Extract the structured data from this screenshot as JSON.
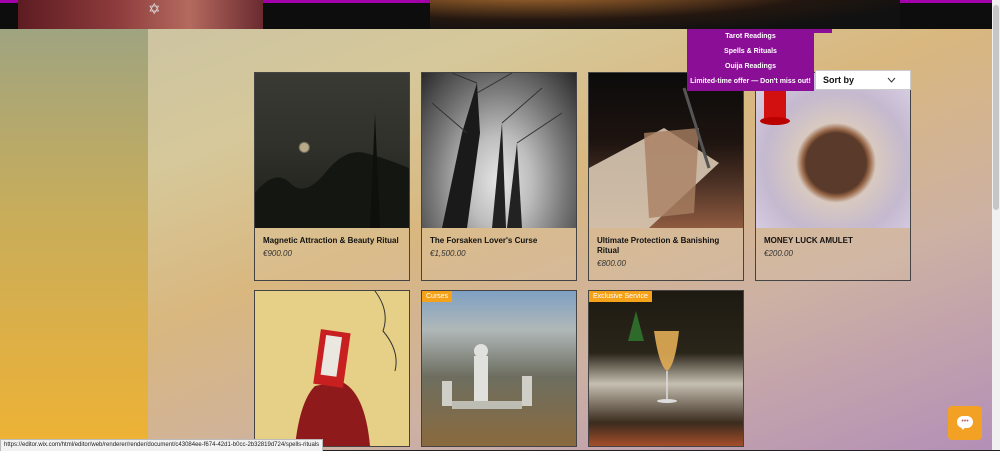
{
  "menu": {
    "items": [
      {
        "label": "Tarot Readings"
      },
      {
        "label": "Spells & Rituals"
      },
      {
        "label": "Ouija Readings"
      },
      {
        "label": "Limited-time offer — Don't miss out!"
      }
    ]
  },
  "sort": {
    "label": "Sort by"
  },
  "products": [
    {
      "title": "Magnetic Attraction & Beauty Ritual",
      "price": "€900.00",
      "ribbon": "",
      "image": "moon-photo"
    },
    {
      "title": "The Forsaken Lover's Curse",
      "price": "€1,500.00",
      "ribbon": "",
      "image": "trees-photo"
    },
    {
      "title": "Ultimate Protection & Banishing Ritual",
      "price": "€800.00",
      "ribbon": "",
      "image": "book-photo"
    },
    {
      "title": "MONEY LUCK AMULET",
      "price": "€200.00",
      "ribbon": "",
      "image": "amulet-photo"
    },
    {
      "title": "",
      "price": "",
      "ribbon": "",
      "image": "hooded-figure-photo"
    },
    {
      "title": "",
      "price": "",
      "ribbon": "Curses",
      "image": "cemetery-photo"
    },
    {
      "title": "",
      "price": "",
      "ribbon": "Exclusive Service",
      "image": "restaurant-photo"
    }
  ],
  "status_url": "https://editor.wix.com/html/editor/web/renderer/render/document/c43084ee-f674-42d1-b0cc-2b32819d724/spells-rituals",
  "colors": {
    "menu_bg": "#8a0f96",
    "accent_line": "#a200a8",
    "ribbon": "#f4a21a",
    "chat_button": "#f3a125"
  },
  "icons": {
    "chat": "chat-bubble-icon",
    "sort": "chevron-down-icon",
    "star": "star-icon"
  }
}
